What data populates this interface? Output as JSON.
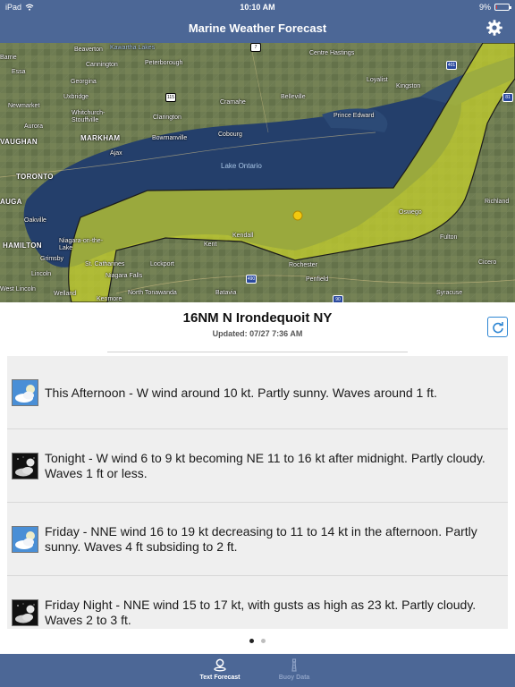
{
  "status_bar": {
    "device": "iPad",
    "time": "10:10 AM",
    "battery_percent": "9%",
    "battery_level": 0.09
  },
  "nav": {
    "title": "Marine Weather Forecast",
    "settings_icon": "gear-icon"
  },
  "map": {
    "water_label": "Lake Ontario",
    "labels": [
      "Beaverton",
      "Kawartha Lakes",
      "Barrie",
      "Cannington",
      "Peterborough",
      "Centre Hastings",
      "Essa",
      "Georgina",
      "Loyalist",
      "Kingston",
      "Uxbridge",
      "Cramahe",
      "Belleville",
      "Newmarket",
      "Whitchurch-Stouffville",
      "Clarington",
      "Prince Edward",
      "Aurora",
      "MARKHAM",
      "Bowmanville",
      "Cobourg",
      "VAUGHAN",
      "Ajax",
      "TORONTO",
      "AUGA",
      "Oakville",
      "Oswego",
      "Richland",
      "HAMILTON",
      "Niagara-on-the-Lake",
      "Kent",
      "Kendall",
      "Fulton",
      "Grimsby",
      "Lockport",
      "Rochester",
      "Cicero",
      "St. Catharines",
      "Niagara Falls",
      "Lincoln",
      "Penfield",
      "West Lincoln",
      "Welland",
      "North Tonawanda",
      "Batavia",
      "Syracuse",
      "Kenmore"
    ],
    "shields": [
      "7",
      "401",
      "115",
      "81",
      "490",
      "90"
    ],
    "marker_color": "#f2c80f",
    "zone_color": "#c8d32b"
  },
  "location": {
    "title": "16NM N Irondequoit NY",
    "updated": "Updated: 07/27 7:36 AM",
    "refresh_icon": "refresh-icon"
  },
  "forecasts": [
    {
      "icon": "partly-sunny-icon",
      "text": "This Afternoon - W wind around 10 kt. Partly sunny. Waves around 1 ft."
    },
    {
      "icon": "partly-cloudy-night-icon",
      "text": "Tonight - W wind 6 to 9 kt becoming NE 11 to 16 kt after midnight. Partly cloudy. Waves 1 ft or less."
    },
    {
      "icon": "partly-sunny-icon",
      "text": "Friday - NNE wind 16 to 19 kt decreasing to 11 to 14 kt in the afternoon. Partly sunny. Waves 4 ft subsiding to 2 ft."
    },
    {
      "icon": "partly-cloudy-night-icon",
      "text": "Friday Night - NNE wind 15 to 17 kt, with gusts as high as 23 kt. Partly cloudy. Waves 2 to 3 ft."
    }
  ],
  "pager": {
    "pages": 2,
    "current": 1
  },
  "tabs": [
    {
      "label": "Text Forecast",
      "icon": "location-pin-icon",
      "active": true
    },
    {
      "label": "Buoy Data",
      "icon": "lighthouse-icon",
      "active": false
    }
  ]
}
